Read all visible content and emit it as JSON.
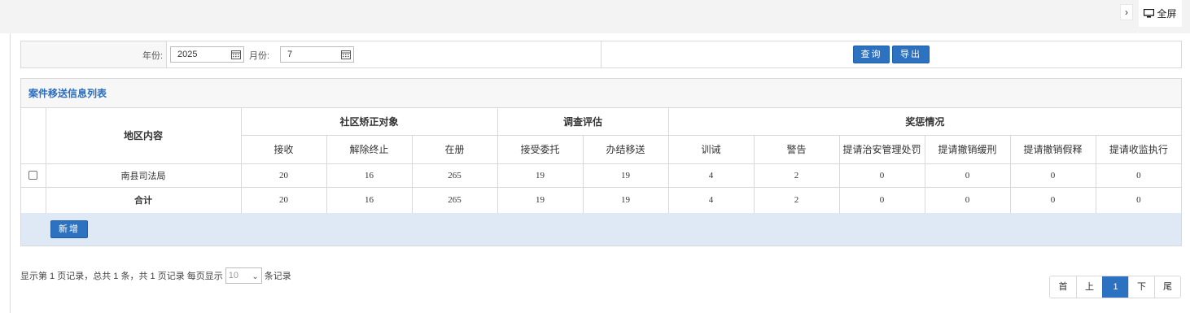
{
  "topbar": {
    "collapse_icon": "chevron-right-icon",
    "fullscreen_icon": "monitor-icon",
    "fullscreen_label": "全屏"
  },
  "filter": {
    "year_label": "年份:",
    "year_value": "2025",
    "month_label": "月份:",
    "month_value": "7",
    "query_label": "查询",
    "export_label": "导出"
  },
  "panel": {
    "title": "案件移送信息列表",
    "header": {
      "region": "地区内容",
      "group1": "社区矫正对象",
      "group2": "调查评估",
      "group3": "奖惩情况",
      "columns": [
        "接收",
        "解除终止",
        "在册",
        "接受委托",
        "办结移送",
        "训诫",
        "警告",
        "提请治安管理处罚",
        "提请撤销缓刑",
        "提请撤销假释",
        "提请收监执行"
      ]
    },
    "rows": [
      {
        "name": "南县司法局",
        "values": [
          "20",
          "16",
          "265",
          "19",
          "19",
          "4",
          "2",
          "0",
          "0",
          "0",
          "0"
        ]
      }
    ],
    "total": {
      "name": "合计",
      "values": [
        "20",
        "16",
        "265",
        "19",
        "19",
        "4",
        "2",
        "0",
        "0",
        "0",
        "0"
      ]
    },
    "add_label": "新增"
  },
  "pagination": {
    "info_prefix": "显示第 1 页记录，总共 1 条，共 1 页记录 每页显示",
    "page_size": "10",
    "info_suffix": "条记录",
    "first": "首",
    "prev": "上",
    "current": "1",
    "next": "下",
    "last": "尾"
  },
  "colors": {
    "accent": "#2d72c0",
    "title_blue": "#2a6dbf",
    "add_bar_bg": "#dfe9f6"
  }
}
